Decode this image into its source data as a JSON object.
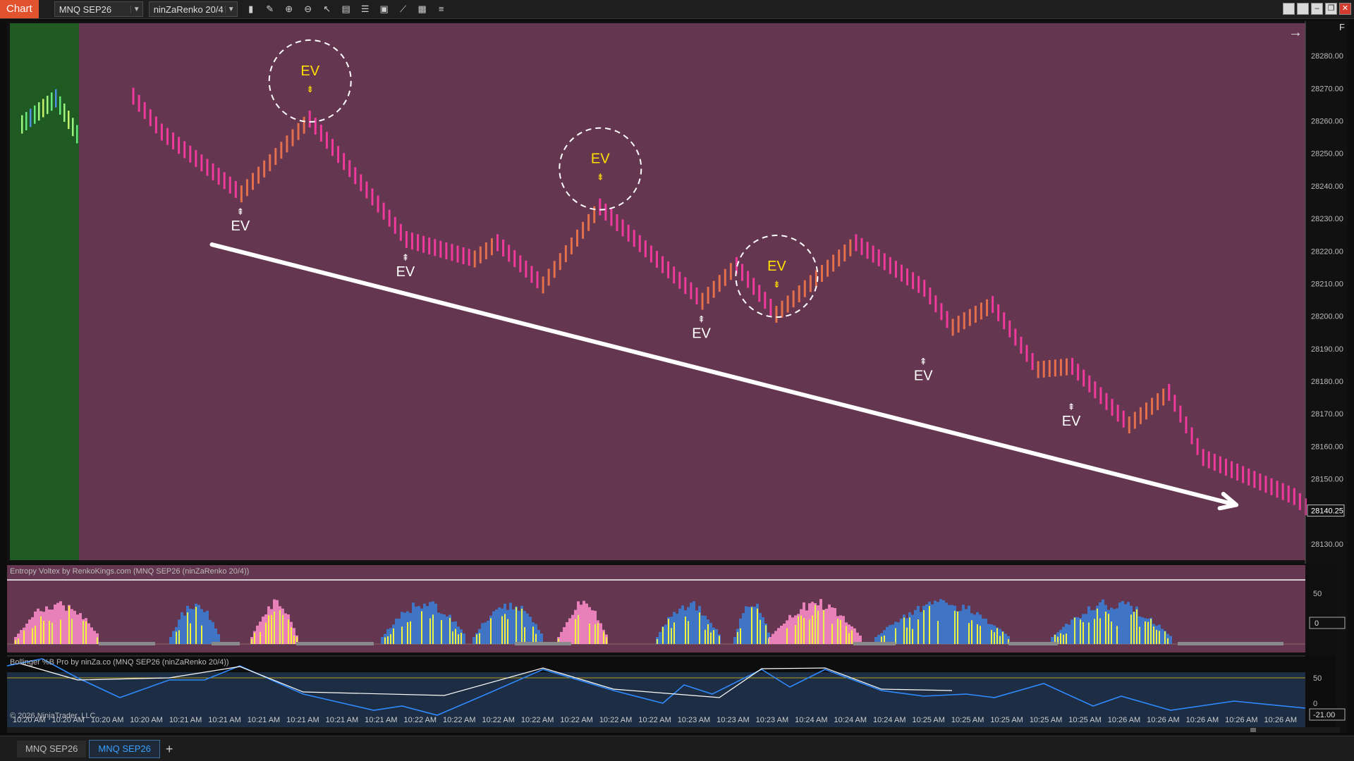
{
  "toolbar": {
    "app_tab": "Chart",
    "instrument": "MNQ SEP26",
    "bar_type": "ninZaRenko 20/4",
    "icons": [
      "bar-type-icon",
      "draw-icon",
      "zoom-in-icon",
      "zoom-out-icon",
      "pointer-icon",
      "data-box-icon",
      "properties-icon",
      "snapshot-icon",
      "strategies-icon",
      "screenshot-icon",
      "indicators-list-icon"
    ]
  },
  "chart": {
    "f_label": "F",
    "price_labels": [
      "28280.00",
      "28270.00",
      "28260.00",
      "28250.00",
      "28240.00",
      "28230.00",
      "28220.00",
      "28210.00",
      "28200.00",
      "28190.00",
      "28180.00",
      "28170.00",
      "28160.00",
      "28150.00",
      "28140.25",
      "28130.00"
    ],
    "last_price": "28140.25",
    "ev_label": "EV",
    "colors": {
      "bg_bear": "#653650",
      "bg_bull": "#1f5a23",
      "bear_bar": "#ff3aa5",
      "pullback_bar": "#f2764d",
      "up_marker": "#ffffff",
      "down_marker": "#ffe000"
    }
  },
  "panel1": {
    "title": "Entropy Voltex by RenkoKings.com (MNQ SEP26 (ninZaRenko 20/4))",
    "axis_labels": [
      "50"
    ],
    "value_label": "0"
  },
  "panel2": {
    "title": "Bollinger %B Pro by ninZa.co (MNQ SEP26 (ninZaRenko 20/4))",
    "axis_labels": [
      "50",
      "0"
    ],
    "value_label": "-21.00",
    "copyright": "© 2026 NinjaTrader, LLC"
  },
  "time_axis": [
    "10:20 AM",
    "10:20 AM",
    "10:20 AM",
    "10:20 AM",
    "10:21 AM",
    "10:21 AM",
    "10:21 AM",
    "10:21 AM",
    "10:21 AM",
    "10:21 AM",
    "10:22 AM",
    "10:22 AM",
    "10:22 AM",
    "10:22 AM",
    "10:22 AM",
    "10:22 AM",
    "10:22 AM",
    "10:23 AM",
    "10:23 AM",
    "10:23 AM",
    "10:24 AM",
    "10:24 AM",
    "10:24 AM",
    "10:25 AM",
    "10:25 AM",
    "10:25 AM",
    "10:25 AM",
    "10:25 AM",
    "10:26 AM",
    "10:26 AM",
    "10:26 AM",
    "10:26 AM",
    "10:26 AM"
  ],
  "bottom_tabs": [
    "MNQ SEP26",
    "MNQ SEP26"
  ],
  "chart_data": {
    "type": "renko",
    "instrument": "MNQ SEP26",
    "bar_size": "ninZaRenko 20/4",
    "ylim": [
      28125,
      28290
    ],
    "path": [
      [
        0,
        28260
      ],
      [
        8,
        28268
      ],
      [
        13,
        28257
      ],
      [
        27,
        28238
      ],
      [
        39,
        28261
      ],
      [
        56,
        28224
      ],
      [
        68,
        28218
      ],
      [
        72,
        28223
      ],
      [
        80,
        28210
      ],
      [
        90,
        28234
      ],
      [
        108,
        28205
      ],
      [
        114,
        28216
      ],
      [
        121,
        28201
      ],
      [
        135,
        28223
      ],
      [
        147,
        28209
      ],
      [
        152,
        28197
      ],
      [
        159,
        28204
      ],
      [
        167,
        28184
      ],
      [
        173,
        28185
      ],
      [
        183,
        28167
      ],
      [
        190,
        28177
      ],
      [
        196,
        28157
      ],
      [
        212,
        28145
      ],
      [
        215,
        28140.25
      ]
    ],
    "pivots": [
      {
        "x": 27,
        "price": 28238,
        "type": "up"
      },
      {
        "x": 39,
        "price": 28261,
        "type": "down"
      },
      {
        "x": 56,
        "price": 28224,
        "type": "up"
      },
      {
        "x": 90,
        "price": 28234,
        "type": "down"
      },
      {
        "x": 108,
        "price": 28205,
        "type": "up"
      },
      {
        "x": 121,
        "price": 28201,
        "type": "down"
      },
      {
        "x": 147,
        "price": 28192,
        "type": "up"
      },
      {
        "x": 173,
        "price": 28178,
        "type": "up"
      }
    ],
    "trend_arrow": {
      "from": [
        22,
        28222
      ],
      "to": [
        202,
        28142
      ]
    }
  }
}
